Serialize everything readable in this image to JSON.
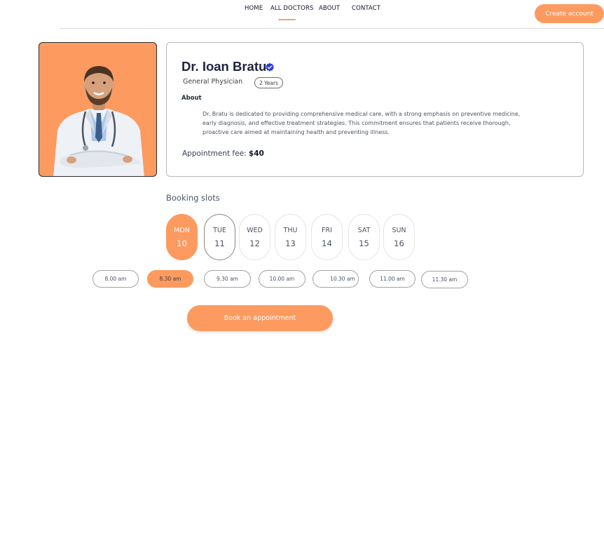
{
  "nav": {
    "items": [
      {
        "label": "HOME"
      },
      {
        "label": "ALL DOCTORS"
      },
      {
        "label": "ABOUT"
      },
      {
        "label": "CONTACT"
      }
    ],
    "active": "ALL DOCTORS",
    "cta_label": "Create account"
  },
  "doctor": {
    "name": "Dr. Ioan Bratu",
    "verified_icon": "verified-badge-icon",
    "speciality": "General Physician",
    "experience": "2 Years",
    "about_label": "About",
    "about_text": "Dr. Bratu is dedicated to providing comprehensive medical care, with a strong emphasis on preventive medicine, early diagnosis, and effective treatment strategies. This commitment ensures that patients receive thorough, proactive care aimed at maintaining health and preventing illness.",
    "fee_label": "Appointment fee:",
    "fee_value": "$40"
  },
  "booking": {
    "title": "Booking slots",
    "days": [
      {
        "name": "MON",
        "date": "10",
        "selected": true
      },
      {
        "name": "TUE",
        "date": "11",
        "selected": false
      },
      {
        "name": "WED",
        "date": "12",
        "selected": false
      },
      {
        "name": "THU",
        "date": "13",
        "selected": false
      },
      {
        "name": "FRI",
        "date": "14",
        "selected": false
      },
      {
        "name": "SAT",
        "date": "15",
        "selected": false
      },
      {
        "name": "SUN",
        "date": "16",
        "selected": false
      }
    ],
    "slots": [
      {
        "time": "8.00 am",
        "selected": false
      },
      {
        "time": "8.30 am",
        "selected": true
      },
      {
        "time": "9.30 am",
        "selected": false
      },
      {
        "time": "10.00 am",
        "selected": false
      },
      {
        "time": "10.30 am",
        "selected": false
      },
      {
        "time": "11.00 am",
        "selected": false
      },
      {
        "time": "11.30 am",
        "selected": false
      }
    ],
    "button_label": "Book an appointment"
  },
  "colors": {
    "accent": "#fd9a5f",
    "verified": "#2a3ed8"
  }
}
